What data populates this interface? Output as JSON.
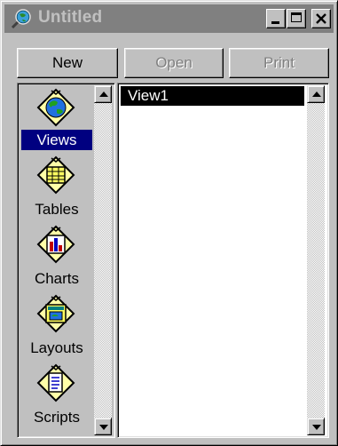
{
  "window": {
    "title": "Untitled",
    "app_icon": "magnifier-globe-icon",
    "controls": {
      "minimize_icon": "minimize-icon",
      "maximize_icon": "maximize-icon",
      "close_icon": "close-icon"
    }
  },
  "toolbar": {
    "new_label": "New",
    "open_label": "Open",
    "print_label": "Print",
    "open_enabled": false,
    "print_enabled": false
  },
  "doc_types": [
    {
      "label": "Views",
      "icon": "globe-icon",
      "selected": true
    },
    {
      "label": "Tables",
      "icon": "table-grid-icon",
      "selected": false
    },
    {
      "label": "Charts",
      "icon": "bar-chart-icon",
      "selected": false
    },
    {
      "label": "Layouts",
      "icon": "layout-map-icon",
      "selected": false
    },
    {
      "label": "Scripts",
      "icon": "script-document-icon",
      "selected": false
    }
  ],
  "documents": [
    {
      "label": "View1",
      "selected": true
    }
  ],
  "colors": {
    "selection": "#000080",
    "titlebar_inactive": "#808080",
    "face": "#c0c0c0",
    "icon_yellow": "#ffffa8"
  }
}
